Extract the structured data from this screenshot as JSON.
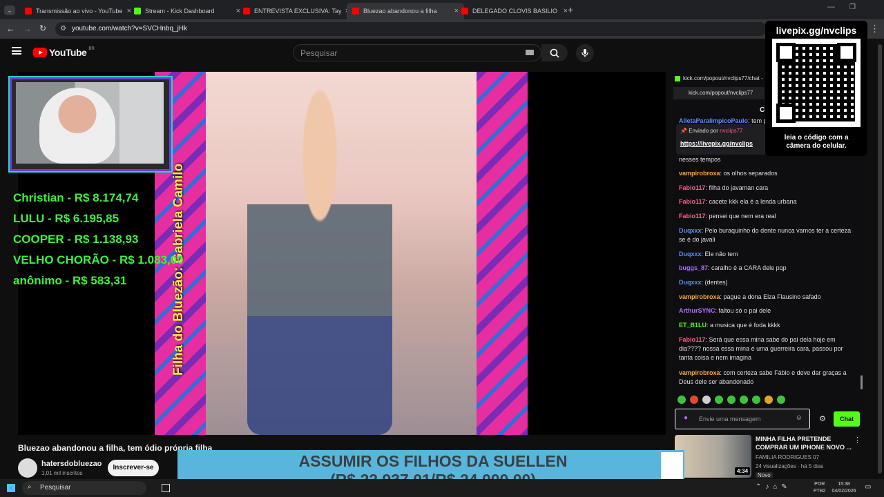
{
  "browser": {
    "tabs": [
      {
        "title": "Transmissão ao vivo - YouTube",
        "color": "#ff0000"
      },
      {
        "title": "Stream - Kick Dashboard",
        "color": "#53fc18"
      },
      {
        "title": "ENTREVISTA EXCLUSIVA: Tayna",
        "color": "#ff0000"
      },
      {
        "title": "Bluezao abandonou a filha",
        "color": "#ff0000"
      },
      {
        "title": "DELEGADO CLOVIS BASILIO - Y",
        "color": "#ff0000"
      }
    ],
    "url": "youtube.com/watch?v=SVCHnbq_jHk"
  },
  "youtube": {
    "logo": "YouTube",
    "country": "BR",
    "search_placeholder": "Pesquisar"
  },
  "overlay": {
    "donations": [
      "Christian - R$ 8.174,74",
      "LULU - R$ 6.195,85",
      "COOPER - R$ 1.138,93",
      "VELHO CHORÃO - R$ 1.083,00",
      "anônimo - R$ 583,31"
    ],
    "vertical_text": "Filha do Bluezão: Gabriela Camilo",
    "qr_title": "livepix.gg/nvclips",
    "qr_caption": "leia o código com a câmera do celular.",
    "goal_line1": "ASSUMIR OS FILHOS DA SUELLEN",
    "goal_line2": "(R$ 22.937,01/R$ 24.000,00)",
    "goal_progress": 0.956
  },
  "video": {
    "title": "Bluezao abandonou a filha, tem ódio própria filha",
    "channel": "hatersdobluezao",
    "subscribers": "1,01 mil inscritos",
    "subscribe_label": "Inscrever-se"
  },
  "chat": {
    "popout_title": "kick.com/popout/nvclips77/chat -",
    "popout_url": "kick.com/popout/nvclips77",
    "header": "Cl",
    "pinned_label": "Enviado por",
    "pinned_user": "nvclips77",
    "pinned_link": "https://livepix.gg/nvclips",
    "top_user": "AlletaParalimpicoPaulo",
    "top_text": "tem p",
    "cont_text": "nesses tempos",
    "messages": [
      {
        "user": "vampirobroxa",
        "color": "#f5a742",
        "text": "os olhos separados"
      },
      {
        "user": "Fabio117",
        "color": "#ff5c8a",
        "text": "filha do javaman cara"
      },
      {
        "user": "Fabio117",
        "color": "#ff5c8a",
        "text": "cacete kkk ela é a lenda urbana"
      },
      {
        "user": "Fabio117",
        "color": "#ff5c8a",
        "text": "pensei que nem era real"
      },
      {
        "user": "Duqxxx",
        "color": "#5b8cff",
        "text": "Pelo buraquinho do dente nunca vamos ter a certeza se é do javali"
      },
      {
        "user": "Duqxxx",
        "color": "#5b8cff",
        "text": "Ele não tem"
      },
      {
        "user": "buggs_87",
        "color": "#b46cff",
        "text": "caralho é a CARA dele pqp"
      },
      {
        "user": "Duqxxx",
        "color": "#5b8cff",
        "text": "(dentes)"
      },
      {
        "user": "vampirobroxa",
        "color": "#f5a742",
        "text": "pague a dona Elza Flausino safado"
      },
      {
        "user": "ArthurSYNC",
        "color": "#b46cff",
        "text": "faltou só o pai dele"
      },
      {
        "user": "ET_B1LU",
        "color": "#53fc18",
        "text": "a musica que é foda kkkk"
      },
      {
        "user": "Fabio117",
        "color": "#ff5c8a",
        "text": "Será que essa mina sabe do pai dela hoje em dia???? nossa essa mina é uma guerreira cara, passou por tanta coisa e nem imagina"
      },
      {
        "user": "vampirobroxa",
        "color": "#f5a742",
        "text": "com certeza sabe Fábio e deve dar graças a Deus dele ser abandonado"
      }
    ],
    "input_placeholder": "Envie uma mensagem",
    "send_label": "Chat"
  },
  "recommended": {
    "title": "MINHA FILHA PRETENDE COMPRAR UM IPHONE NOVO ...",
    "channel": "FAMILIA RODRIGUES 07",
    "meta": "24 visualizações · há 5 dias",
    "badge": "Novo",
    "duration": "4:34"
  },
  "taskbar": {
    "search": "Pesquisar",
    "lang1": "POR",
    "lang2": "PTB2",
    "time": "15:38",
    "date": "04/02/2026"
  }
}
